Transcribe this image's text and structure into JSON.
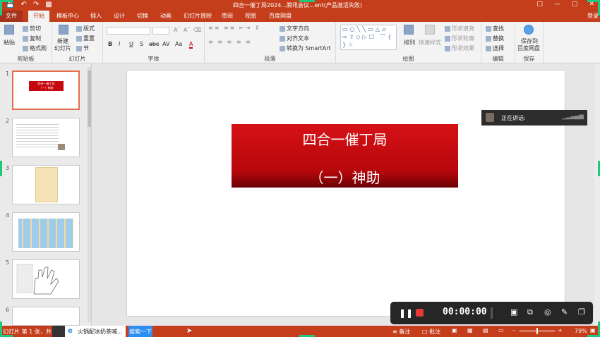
{
  "title_bar": {
    "title": "四合一催丁局2024...腾讯会议...ent(产品激活失败)",
    "quick_access": [
      "save-icon",
      "undo-icon",
      "redo-icon",
      "start-slideshow-icon"
    ],
    "window_buttons": [
      "ribbon-options-icon",
      "minimize-icon",
      "maximize-icon",
      "close-icon"
    ]
  },
  "menu": {
    "file": "文件",
    "tabs": [
      "开始",
      "模板中心",
      "插入",
      "设计",
      "切换",
      "动画",
      "幻灯片放映",
      "审阅",
      "视图",
      "百度网盘"
    ],
    "login": "登录"
  },
  "ribbon": {
    "clipboard": {
      "paste": "粘贴",
      "cut": "剪切",
      "copy": "复制",
      "format_painter": "格式刷",
      "label": "剪贴板"
    },
    "slides": {
      "new_slide": "新建",
      "new_slide_2": "幻灯片",
      "layout": "版式",
      "reset": "重置",
      "section": "节",
      "label": "幻灯片"
    },
    "font": {
      "bold": "B",
      "italic": "I",
      "underline": "U",
      "shadow": "S",
      "strike": "abc",
      "spacing": "AV",
      "case": "Aa",
      "font_color": "A",
      "label": "字体"
    },
    "paragraph": {
      "text_direction": "文字方向",
      "align_text": "对齐文本",
      "smartart": "转换为 SmartArt",
      "label": "段落"
    },
    "drawing": {
      "shapes_preview": "▭○╲╲▭△▱ ⇨⇧◇▷☐ ⌒{ }☆",
      "arrange": "排列",
      "quick_styles": "快速样式",
      "shape_fill": "形状填充",
      "shape_outline": "形状轮廓",
      "shape_effects": "形状效果",
      "label": "绘图"
    },
    "editing": {
      "find": "查找",
      "replace": "替换",
      "select": "选择",
      "label": "编辑"
    },
    "save": {
      "save_to": "保存到",
      "baidu": "百度网盘",
      "label": "保存"
    }
  },
  "thumbnails": [
    {
      "num": "1",
      "selected": true,
      "title": "四合一催丁局",
      "subtitle": "（一）神助"
    },
    {
      "num": "2",
      "selected": false
    },
    {
      "num": "3",
      "selected": false
    },
    {
      "num": "4",
      "selected": false
    },
    {
      "num": "5",
      "selected": false
    },
    {
      "num": "6",
      "selected": false
    }
  ],
  "slide": {
    "title": "四合一催丁局",
    "subtitle": "（一）神助"
  },
  "meeting": {
    "speaking_label": "正在讲话:"
  },
  "recorder": {
    "time": "00:00:00",
    "buttons": [
      "pause-icon",
      "stop-icon",
      "fit-screen-icon",
      "fullscreen-icon",
      "camera-icon",
      "pen-icon",
      "window-icon"
    ]
  },
  "status_bar": {
    "slide_info": "幻灯片 第 1 张，共",
    "taskbar_app": "火锅配冰奶茶喊...",
    "search_button": "搜索一下",
    "notes": "备注",
    "comments": "批注",
    "zoom": "79%"
  },
  "colors": {
    "accent": "#c43e1c",
    "slide_title_bg": "#c4080d",
    "highlight": "#1ec97b"
  }
}
